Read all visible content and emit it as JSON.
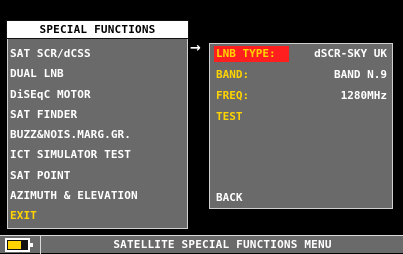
{
  "left_panel": {
    "title": "SPECIAL FUNCTIONS",
    "items": [
      {
        "label": "SAT SCR/dCSS"
      },
      {
        "label": "DUAL LNB"
      },
      {
        "label": "DiSEqC MOTOR"
      },
      {
        "label": "SAT FINDER"
      },
      {
        "label": "BUZZ&NOIS.MARG.GR."
      },
      {
        "label": "ICT SIMULATOR TEST"
      },
      {
        "label": "SAT POINT"
      },
      {
        "label": "AZIMUTH & ELEVATION"
      },
      {
        "label": "EXIT"
      }
    ]
  },
  "arrow_glyph": "→",
  "right_panel": {
    "rows": [
      {
        "label": "LNB TYPE:",
        "value": "dSCR-SKY UK",
        "selected": true
      },
      {
        "label": "BAND:",
        "value": "BAND N.9"
      },
      {
        "label": "FREQ:",
        "value": "1280MHz"
      },
      {
        "label": "TEST",
        "value": ""
      }
    ],
    "back_label": "BACK"
  },
  "status_bar": {
    "title": "SATELLITE SPECIAL FUNCTIONS MENU",
    "battery_level": 0.7
  },
  "colors": {
    "panel": "#6a6a6a",
    "highlight": "#ff1f1f",
    "accent": "#ffd400",
    "text": "#ffffff",
    "background": "#000000"
  }
}
